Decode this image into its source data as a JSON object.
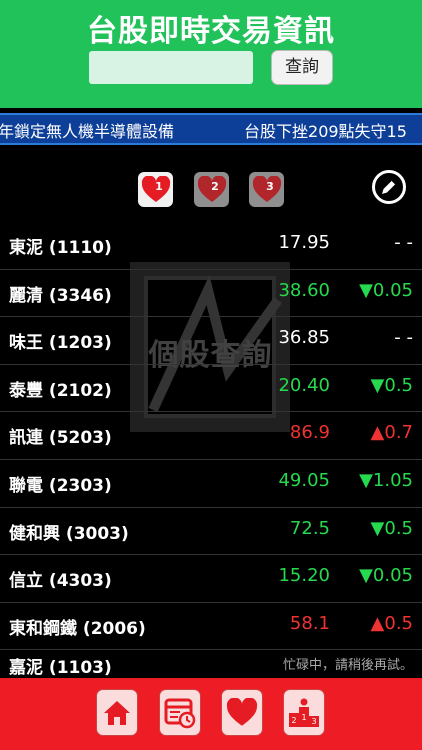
{
  "header": {
    "title": "台股即時交易資訊",
    "search_placeholder": "",
    "search_button": "查詢"
  },
  "ticker": {
    "items": [
      "年鎖定無人機半導體設備",
      "台股下挫209點失守15"
    ]
  },
  "toolbar": {
    "tabs": [
      {
        "label": "1",
        "active": true
      },
      {
        "label": "2",
        "active": false
      },
      {
        "label": "3",
        "active": false
      }
    ],
    "edit_icon": "pencil-icon"
  },
  "watermark": {
    "text": "個股查詢"
  },
  "stocks": [
    {
      "name": "東泥 (1110)",
      "price": "17.95",
      "change": "- -",
      "trend": "flat"
    },
    {
      "name": "麗清 (3346)",
      "price": "38.60",
      "change": "▼0.05",
      "trend": "down"
    },
    {
      "name": "味王 (1203)",
      "price": "36.85",
      "change": "- -",
      "trend": "flat"
    },
    {
      "name": "泰豐 (2102)",
      "price": "20.40",
      "change": "▼0.5",
      "trend": "down"
    },
    {
      "name": "訊連 (5203)",
      "price": "86.9",
      "change": "▲0.7",
      "trend": "up"
    },
    {
      "name": "聯電 (2303)",
      "price": "49.05",
      "change": "▼1.05",
      "trend": "down"
    },
    {
      "name": "健和興 (3003)",
      "price": "72.5",
      "change": "▼0.5",
      "trend": "down"
    },
    {
      "name": "信立 (4303)",
      "price": "15.20",
      "change": "▼0.05",
      "trend": "down"
    },
    {
      "name": "東和鋼鐵 (2006)",
      "price": "58.1",
      "change": "▲0.5",
      "trend": "up"
    }
  ],
  "partial_row": {
    "name": "嘉泥 (1103)",
    "message": "忙碌中，請稍後再試。"
  },
  "colors": {
    "up": "#ef3232",
    "down": "#27d94e",
    "flat": "#ffffff",
    "header": "#22c25a",
    "bottom_bar": "#ee1c25"
  },
  "bottom_nav": [
    "home-icon",
    "news-clock-icon",
    "heart-icon",
    "ranking-podium-icon"
  ]
}
